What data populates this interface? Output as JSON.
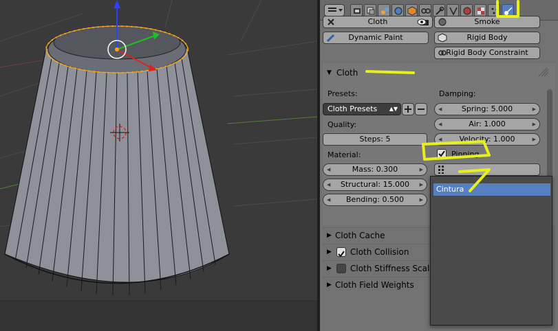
{
  "properties": {
    "top_row": {
      "cloth": "Cloth",
      "smoke": "Smoke"
    },
    "buttons": {
      "dynamic_paint": "Dynamic Paint",
      "rigid_body": "Rigid Body",
      "rigid_body_constraint": "Rigid Body Constraint"
    },
    "cloth_panel": {
      "title": "Cloth",
      "presets_label": "Presets:",
      "presets_value": "Cloth Presets",
      "quality_label": "Quality:",
      "steps": "Steps: 5",
      "material_label": "Material:",
      "mass": "Mass: 0.300",
      "structural": "Structural: 15.000",
      "bending": "Bending: 0.500",
      "damping_label": "Damping:",
      "spring": "Spring: 5.000",
      "air": "Air: 1.000",
      "velocity": "Velocity: 1.000",
      "pinning": "Pinning",
      "pinning_checked": true
    },
    "subpanels": [
      {
        "label": "Cloth Cache"
      },
      {
        "label": "Cloth Collision",
        "checked": true
      },
      {
        "label": "Cloth Stiffness Scaling",
        "checked": false
      },
      {
        "label": "Cloth Field Weights"
      }
    ],
    "dropdown": {
      "items": [
        "Cintura"
      ]
    }
  },
  "colors": {
    "highlight": "#e8f01a",
    "selected_edge": "#f5a623",
    "active_tab": "#5680c2"
  },
  "icons": [
    "editor-type-icon",
    "render-icon",
    "scene-icon",
    "world-icon",
    "object-icon",
    "modifier-icon",
    "physics-icon",
    "vertex-group-icon"
  ]
}
